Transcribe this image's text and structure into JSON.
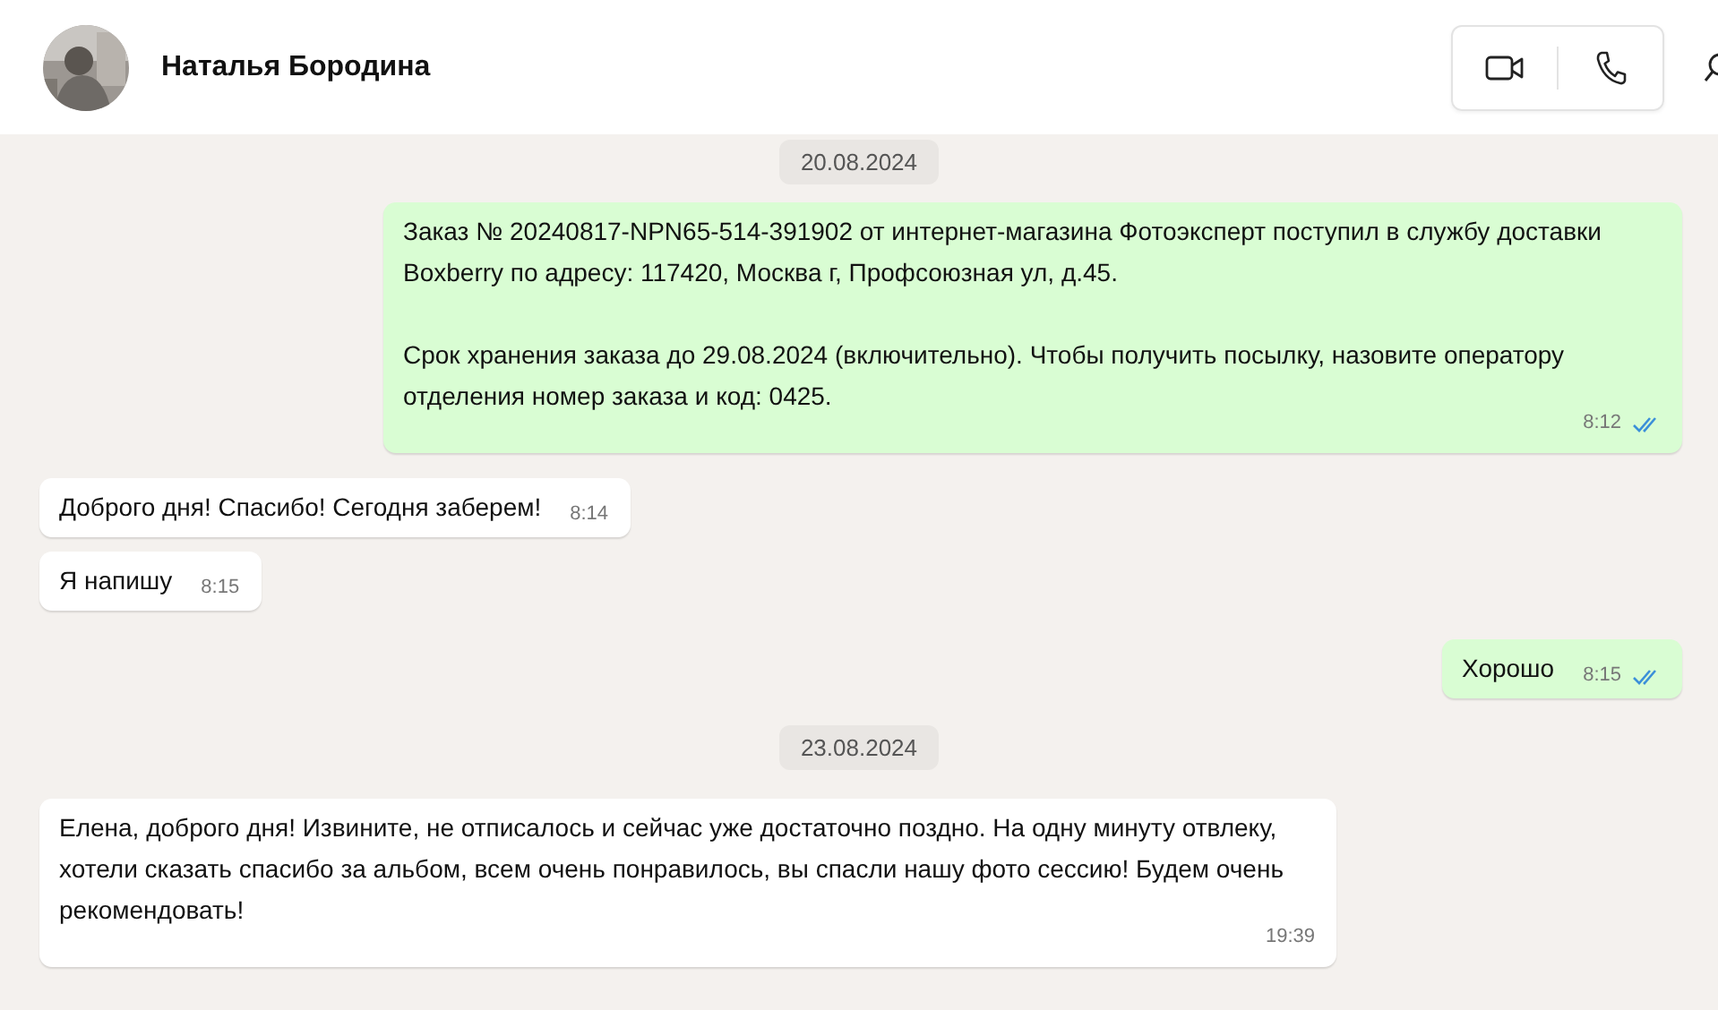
{
  "header": {
    "contact_name": "Наталья Бородина"
  },
  "messages": [
    {
      "kind": "date",
      "text": "20.08.2024"
    },
    {
      "kind": "out",
      "paragraphs": [
        "Заказ № 20240817-NPN65-514-391902 от интернет-магазина Фотоэксперт поступил в службу доставки Boxberry по адресу: 117420, Москва г, Профсоюзная ул, д.45.",
        "Срок хранения заказа до 29.08.2024 (включительно). Чтобы получить посылку, назовите оператору отделения номер заказа и код: 0425."
      ],
      "time": "8:12",
      "read": true
    },
    {
      "kind": "in",
      "paragraphs": [
        "Доброго дня! Спасибо!  Сегодня заберем!"
      ],
      "time": "8:14"
    },
    {
      "kind": "in",
      "paragraphs": [
        "Я напишу"
      ],
      "time": "8:15"
    },
    {
      "kind": "out",
      "paragraphs": [
        "Хорошо"
      ],
      "time": "8:15",
      "read": true
    },
    {
      "kind": "date",
      "text": "23.08.2024"
    },
    {
      "kind": "in",
      "paragraphs": [
        "Елена, доброго дня! Извините, не отписалось и сейчас уже достаточно поздно. На одну минуту отвлеку, хотели сказать спасибо за альбом, всем очень понравилось, вы спасли нашу фото сессию! Будем очень рекомендовать!"
      ],
      "time": "19:39"
    }
  ]
}
